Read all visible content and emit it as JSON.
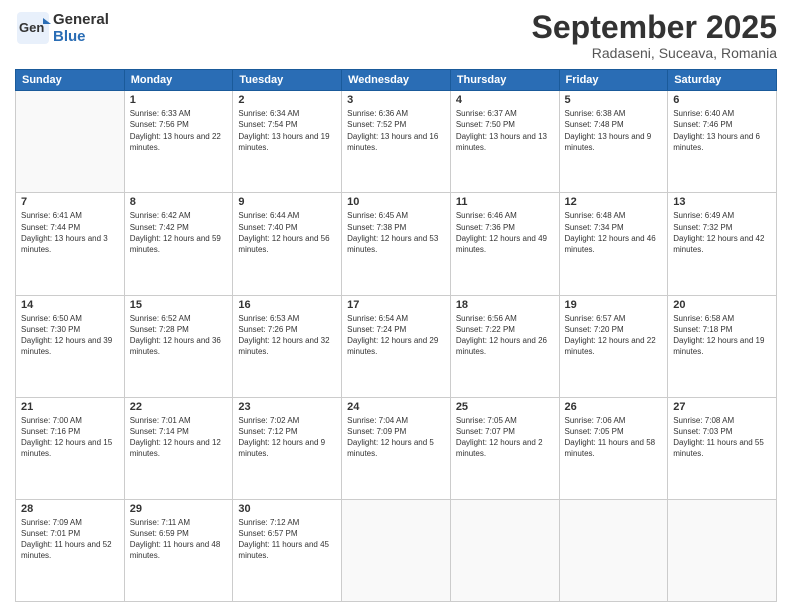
{
  "header": {
    "logo_general": "General",
    "logo_blue": "Blue",
    "month": "September 2025",
    "location": "Radaseni, Suceava, Romania"
  },
  "weekdays": [
    "Sunday",
    "Monday",
    "Tuesday",
    "Wednesday",
    "Thursday",
    "Friday",
    "Saturday"
  ],
  "weeks": [
    [
      {
        "day": "",
        "sunrise": "",
        "sunset": "",
        "daylight": ""
      },
      {
        "day": "1",
        "sunrise": "Sunrise: 6:33 AM",
        "sunset": "Sunset: 7:56 PM",
        "daylight": "Daylight: 13 hours and 22 minutes."
      },
      {
        "day": "2",
        "sunrise": "Sunrise: 6:34 AM",
        "sunset": "Sunset: 7:54 PM",
        "daylight": "Daylight: 13 hours and 19 minutes."
      },
      {
        "day": "3",
        "sunrise": "Sunrise: 6:36 AM",
        "sunset": "Sunset: 7:52 PM",
        "daylight": "Daylight: 13 hours and 16 minutes."
      },
      {
        "day": "4",
        "sunrise": "Sunrise: 6:37 AM",
        "sunset": "Sunset: 7:50 PM",
        "daylight": "Daylight: 13 hours and 13 minutes."
      },
      {
        "day": "5",
        "sunrise": "Sunrise: 6:38 AM",
        "sunset": "Sunset: 7:48 PM",
        "daylight": "Daylight: 13 hours and 9 minutes."
      },
      {
        "day": "6",
        "sunrise": "Sunrise: 6:40 AM",
        "sunset": "Sunset: 7:46 PM",
        "daylight": "Daylight: 13 hours and 6 minutes."
      }
    ],
    [
      {
        "day": "7",
        "sunrise": "Sunrise: 6:41 AM",
        "sunset": "Sunset: 7:44 PM",
        "daylight": "Daylight: 13 hours and 3 minutes."
      },
      {
        "day": "8",
        "sunrise": "Sunrise: 6:42 AM",
        "sunset": "Sunset: 7:42 PM",
        "daylight": "Daylight: 12 hours and 59 minutes."
      },
      {
        "day": "9",
        "sunrise": "Sunrise: 6:44 AM",
        "sunset": "Sunset: 7:40 PM",
        "daylight": "Daylight: 12 hours and 56 minutes."
      },
      {
        "day": "10",
        "sunrise": "Sunrise: 6:45 AM",
        "sunset": "Sunset: 7:38 PM",
        "daylight": "Daylight: 12 hours and 53 minutes."
      },
      {
        "day": "11",
        "sunrise": "Sunrise: 6:46 AM",
        "sunset": "Sunset: 7:36 PM",
        "daylight": "Daylight: 12 hours and 49 minutes."
      },
      {
        "day": "12",
        "sunrise": "Sunrise: 6:48 AM",
        "sunset": "Sunset: 7:34 PM",
        "daylight": "Daylight: 12 hours and 46 minutes."
      },
      {
        "day": "13",
        "sunrise": "Sunrise: 6:49 AM",
        "sunset": "Sunset: 7:32 PM",
        "daylight": "Daylight: 12 hours and 42 minutes."
      }
    ],
    [
      {
        "day": "14",
        "sunrise": "Sunrise: 6:50 AM",
        "sunset": "Sunset: 7:30 PM",
        "daylight": "Daylight: 12 hours and 39 minutes."
      },
      {
        "day": "15",
        "sunrise": "Sunrise: 6:52 AM",
        "sunset": "Sunset: 7:28 PM",
        "daylight": "Daylight: 12 hours and 36 minutes."
      },
      {
        "day": "16",
        "sunrise": "Sunrise: 6:53 AM",
        "sunset": "Sunset: 7:26 PM",
        "daylight": "Daylight: 12 hours and 32 minutes."
      },
      {
        "day": "17",
        "sunrise": "Sunrise: 6:54 AM",
        "sunset": "Sunset: 7:24 PM",
        "daylight": "Daylight: 12 hours and 29 minutes."
      },
      {
        "day": "18",
        "sunrise": "Sunrise: 6:56 AM",
        "sunset": "Sunset: 7:22 PM",
        "daylight": "Daylight: 12 hours and 26 minutes."
      },
      {
        "day": "19",
        "sunrise": "Sunrise: 6:57 AM",
        "sunset": "Sunset: 7:20 PM",
        "daylight": "Daylight: 12 hours and 22 minutes."
      },
      {
        "day": "20",
        "sunrise": "Sunrise: 6:58 AM",
        "sunset": "Sunset: 7:18 PM",
        "daylight": "Daylight: 12 hours and 19 minutes."
      }
    ],
    [
      {
        "day": "21",
        "sunrise": "Sunrise: 7:00 AM",
        "sunset": "Sunset: 7:16 PM",
        "daylight": "Daylight: 12 hours and 15 minutes."
      },
      {
        "day": "22",
        "sunrise": "Sunrise: 7:01 AM",
        "sunset": "Sunset: 7:14 PM",
        "daylight": "Daylight: 12 hours and 12 minutes."
      },
      {
        "day": "23",
        "sunrise": "Sunrise: 7:02 AM",
        "sunset": "Sunset: 7:12 PM",
        "daylight": "Daylight: 12 hours and 9 minutes."
      },
      {
        "day": "24",
        "sunrise": "Sunrise: 7:04 AM",
        "sunset": "Sunset: 7:09 PM",
        "daylight": "Daylight: 12 hours and 5 minutes."
      },
      {
        "day": "25",
        "sunrise": "Sunrise: 7:05 AM",
        "sunset": "Sunset: 7:07 PM",
        "daylight": "Daylight: 12 hours and 2 minutes."
      },
      {
        "day": "26",
        "sunrise": "Sunrise: 7:06 AM",
        "sunset": "Sunset: 7:05 PM",
        "daylight": "Daylight: 11 hours and 58 minutes."
      },
      {
        "day": "27",
        "sunrise": "Sunrise: 7:08 AM",
        "sunset": "Sunset: 7:03 PM",
        "daylight": "Daylight: 11 hours and 55 minutes."
      }
    ],
    [
      {
        "day": "28",
        "sunrise": "Sunrise: 7:09 AM",
        "sunset": "Sunset: 7:01 PM",
        "daylight": "Daylight: 11 hours and 52 minutes."
      },
      {
        "day": "29",
        "sunrise": "Sunrise: 7:11 AM",
        "sunset": "Sunset: 6:59 PM",
        "daylight": "Daylight: 11 hours and 48 minutes."
      },
      {
        "day": "30",
        "sunrise": "Sunrise: 7:12 AM",
        "sunset": "Sunset: 6:57 PM",
        "daylight": "Daylight: 11 hours and 45 minutes."
      },
      {
        "day": "",
        "sunrise": "",
        "sunset": "",
        "daylight": ""
      },
      {
        "day": "",
        "sunrise": "",
        "sunset": "",
        "daylight": ""
      },
      {
        "day": "",
        "sunrise": "",
        "sunset": "",
        "daylight": ""
      },
      {
        "day": "",
        "sunrise": "",
        "sunset": "",
        "daylight": ""
      }
    ]
  ]
}
